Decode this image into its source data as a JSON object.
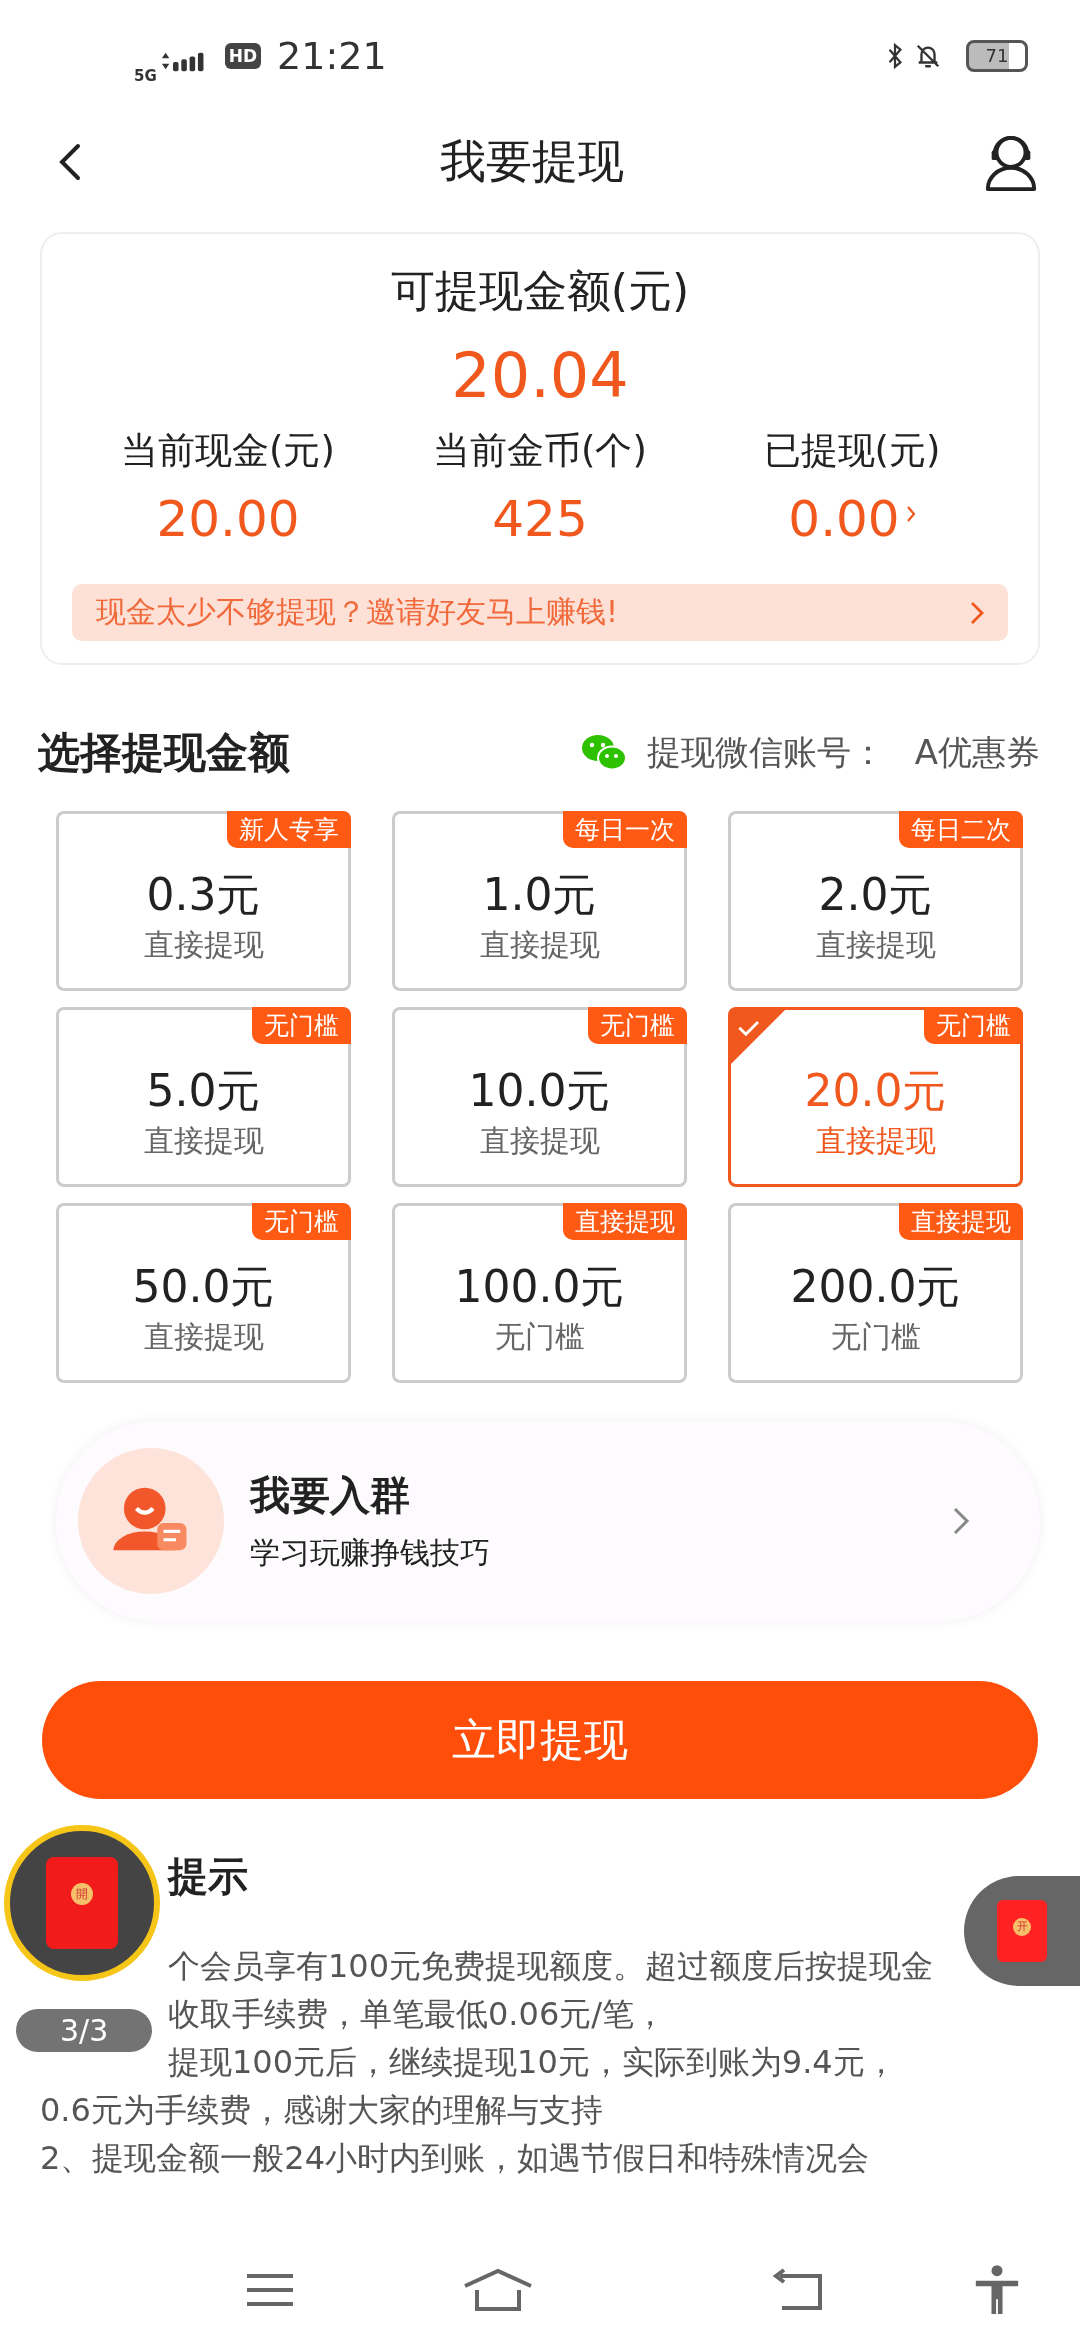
{
  "status_bar": {
    "network": "5G",
    "hd": "HD",
    "time": "21:21",
    "battery": "71"
  },
  "header": {
    "title": "我要提现"
  },
  "balance": {
    "title": "可提现金额(元)",
    "amount": "20.04",
    "stats": [
      {
        "label": "当前现金(元)",
        "value": "20.00",
        "link": false
      },
      {
        "label": "当前金币(个)",
        "value": "425",
        "link": false
      },
      {
        "label": "已提现(元)",
        "value": "0.00",
        "link": true
      }
    ],
    "invite": "现金太少不够提现？邀请好友马上赚钱!"
  },
  "section": {
    "title": "选择提现金额",
    "account_label": "提现微信账号：",
    "account": "A优惠券"
  },
  "options": [
    {
      "tag": "新人专享",
      "amount": "0.3元",
      "note": "直接提现",
      "selected": false
    },
    {
      "tag": "每日一次",
      "amount": "1.0元",
      "note": "直接提现",
      "selected": false
    },
    {
      "tag": "每日二次",
      "amount": "2.0元",
      "note": "直接提现",
      "selected": false
    },
    {
      "tag": "无门槛",
      "amount": "5.0元",
      "note": "直接提现",
      "selected": false
    },
    {
      "tag": "无门槛",
      "amount": "10.0元",
      "note": "直接提现",
      "selected": false
    },
    {
      "tag": "无门槛",
      "amount": "20.0元",
      "note": "直接提现",
      "selected": true
    },
    {
      "tag": "无门槛",
      "amount": "50.0元",
      "note": "直接提现",
      "selected": false
    },
    {
      "tag": "直接提现",
      "amount": "100.0元",
      "note": "无门槛",
      "selected": false
    },
    {
      "tag": "直接提现",
      "amount": "200.0元",
      "note": "无门槛",
      "selected": false
    }
  ],
  "group": {
    "title": "我要入群",
    "subtitle": "学习玩赚挣钱技巧"
  },
  "submit": "立即提现",
  "notice": {
    "title": "提示",
    "lines": [
      {
        "kind": "partial",
        "text": "个会员享有100元免费提现额度。超过额度后按提现金"
      },
      {
        "kind": "partial",
        "text": "收取手续费，单笔最低0.06元/笔，"
      },
      {
        "kind": "partial",
        "text": "提现100元后，继续提现10元，实际到账为9.4元，"
      },
      {
        "kind": "full",
        "text": "0.6元为手续费，感谢大家的理解与支持"
      },
      {
        "kind": "full",
        "text": "2、提现金额一般24小时内到账，如遇节假日和特殊情况会"
      }
    ]
  },
  "float_left": {
    "glyph": "開",
    "page": "3/3"
  },
  "float_right": {
    "glyph": "开"
  }
}
